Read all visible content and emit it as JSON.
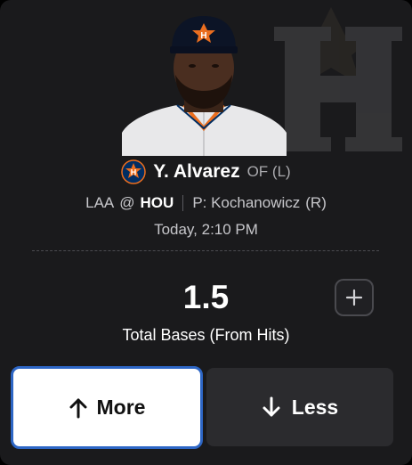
{
  "player": {
    "name": "Y. Alvarez",
    "position": "OF (L)",
    "team_logo": "houston-astros-logo",
    "headshot": "player-headshot"
  },
  "matchup": {
    "away": "LAA",
    "at": "@",
    "home": "HOU",
    "pitcher": "P: Kochanowicz",
    "pitcher_hand": "(R)"
  },
  "game_time": "Today, 2:10 PM",
  "projection": {
    "line": "1.5",
    "stat": "Total Bases (From Hits)"
  },
  "actions": {
    "more_label": "More",
    "less_label": "Less",
    "plus_icon": "plus-icon",
    "more_icon": "arrow-up-icon",
    "less_icon": "arrow-down-icon"
  },
  "colors": {
    "card_bg": "#1a1a1c",
    "selected_border": "#2d66c5",
    "astros_navy": "#002d62",
    "astros_orange": "#eb6e1f"
  }
}
